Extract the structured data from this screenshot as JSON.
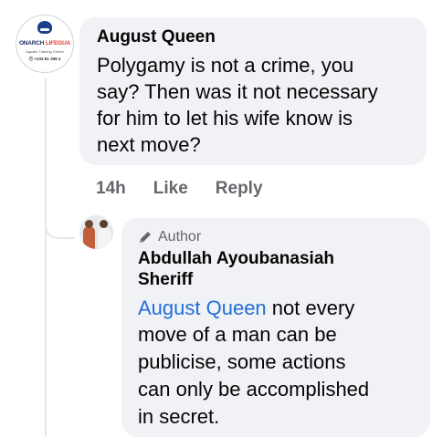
{
  "comment": {
    "author": "August Queen",
    "text_lines": [
      "Polygamy is not a crime, you",
      "say? Then was it not necessary",
      "for him to let his wife know is",
      "next move?"
    ],
    "avatar": {
      "brand_main": "ONARCH ",
      "brand_accent": "LIFEGUA",
      "tagline": "Aquatic Training Centre",
      "phone": "Ⓣ +234 81 398 4"
    },
    "time": "14h",
    "like_label": "Like",
    "reply_label": "Reply"
  },
  "reply": {
    "badge_label": "Author",
    "badge_icon": "pencil-icon",
    "author_line1": "Abdullah Ayoubanasiah",
    "author_line2": "Sheriff",
    "mention": "August Queen",
    "text_line1_rest": " not every",
    "text_lines": [
      "move of a man can be",
      "publicise, some actions",
      "can only be accomplished",
      "in secret."
    ]
  },
  "colors": {
    "bubble": "#f0f2f5",
    "mention": "#216fdb",
    "muted": "#65676b"
  }
}
